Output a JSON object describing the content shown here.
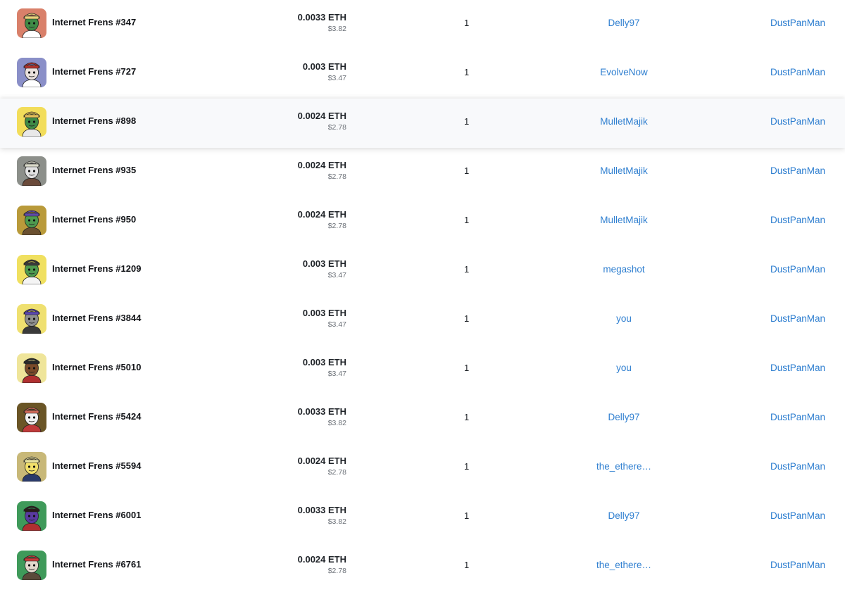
{
  "activity": {
    "rows": [
      {
        "name": "Internet Frens #347",
        "eth": "0.0033 ETH",
        "usd": "$3.82",
        "quantity": "1",
        "from": "Delly97",
        "to": "DustPanMan",
        "thumb": {
          "bg": "#d9806a",
          "skin": "#3f8a46",
          "hat": "#e8d07a",
          "shirt": "#ffffff"
        }
      },
      {
        "name": "Internet Frens #727",
        "eth": "0.003 ETH",
        "usd": "$3.47",
        "quantity": "1",
        "from": "EvolveNow",
        "to": "DustPanMan",
        "thumb": {
          "bg": "#8a8fc8",
          "skin": "#e9e0dc",
          "hat": "#b1322c",
          "shirt": "#ffffff"
        }
      },
      {
        "name": "Internet Frens #898",
        "eth": "0.0024 ETH",
        "usd": "$2.78",
        "quantity": "1",
        "from": "MulletMajik",
        "to": "DustPanMan",
        "thumb": {
          "bg": "#f2dd5a",
          "skin": "#3f8a46",
          "hat": "#e6c05a",
          "shirt": "#e8e8e8"
        }
      },
      {
        "name": "Internet Frens #935",
        "eth": "0.0024 ETH",
        "usd": "$2.78",
        "quantity": "1",
        "from": "MulletMajik",
        "to": "DustPanMan",
        "thumb": {
          "bg": "#8c8f8a",
          "skin": "#e2e2e2",
          "hat": "#d9d9c9",
          "shirt": "#6a4a3a"
        }
      },
      {
        "name": "Internet Frens #950",
        "eth": "0.0024 ETH",
        "usd": "$2.78",
        "quantity": "1",
        "from": "MulletMajik",
        "to": "DustPanMan",
        "thumb": {
          "bg": "#b99a3a",
          "skin": "#4e9a4e",
          "hat": "#5e4aa8",
          "shirt": "#6a5030"
        }
      },
      {
        "name": "Internet Frens #1209",
        "eth": "0.003 ETH",
        "usd": "$3.47",
        "quantity": "1",
        "from": "megashot",
        "to": "DustPanMan",
        "thumb": {
          "bg": "#f0e060",
          "skin": "#4e9a4e",
          "hat": "#3a3a3a",
          "shirt": "#f4f4f4"
        }
      },
      {
        "name": "Internet Frens #3844",
        "eth": "0.003 ETH",
        "usd": "$3.47",
        "quantity": "1",
        "from": "you",
        "to": "DustPanMan",
        "thumb": {
          "bg": "#efe070",
          "skin": "#8e8e8e",
          "hat": "#5b46b0",
          "shirt": "#3a3a3a"
        }
      },
      {
        "name": "Internet Frens #5010",
        "eth": "0.003 ETH",
        "usd": "$3.47",
        "quantity": "1",
        "from": "you",
        "to": "DustPanMan",
        "thumb": {
          "bg": "#efe59a",
          "skin": "#7a4a2a",
          "hat": "#2a2a2a",
          "shirt": "#b03030"
        }
      },
      {
        "name": "Internet Frens #5424",
        "eth": "0.0033 ETH",
        "usd": "$3.82",
        "quantity": "1",
        "from": "Delly97",
        "to": "DustPanMan",
        "thumb": {
          "bg": "#6a5526",
          "skin": "#f0f0f0",
          "hat": "#d06a5a",
          "shirt": "#c03a3a"
        }
      },
      {
        "name": "Internet Frens #5594",
        "eth": "0.0024 ETH",
        "usd": "$2.78",
        "quantity": "1",
        "from": "the_ethere…",
        "to": "DustPanMan",
        "thumb": {
          "bg": "#c8b878",
          "skin": "#f2e06a",
          "hat": "#e9e3a0",
          "shirt": "#2a3a6a"
        }
      },
      {
        "name": "Internet Frens #6001",
        "eth": "0.0033 ETH",
        "usd": "$3.82",
        "quantity": "1",
        "from": "Delly97",
        "to": "DustPanMan",
        "thumb": {
          "bg": "#3f9a5a",
          "skin": "#5a3aa0",
          "hat": "#2a1a1a",
          "shirt": "#b03030"
        }
      },
      {
        "name": "Internet Frens #6761",
        "eth": "0.0024 ETH",
        "usd": "$2.78",
        "quantity": "1",
        "from": "the_ethere…",
        "to": "DustPanMan",
        "thumb": {
          "bg": "#3f9a5a",
          "skin": "#e2d8cc",
          "hat": "#c83a3a",
          "shirt": "#5a4a3a"
        }
      }
    ],
    "hovered_row": 2
  }
}
